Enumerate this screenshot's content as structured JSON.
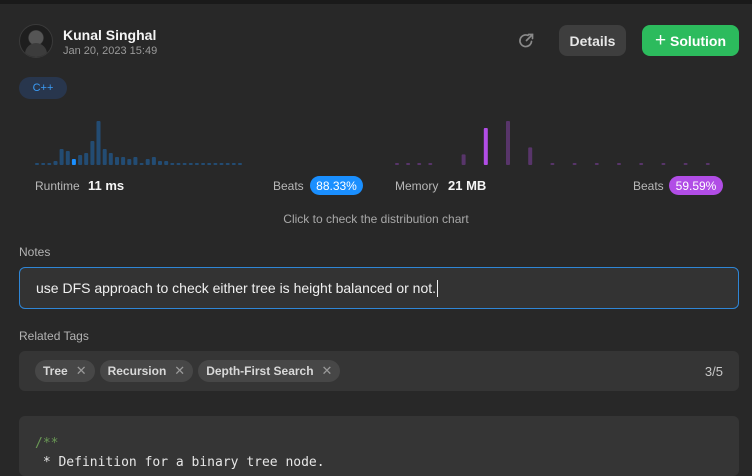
{
  "user": {
    "name": "Kunal Singhal",
    "timestamp": "Jan 20, 2023 15:49"
  },
  "header": {
    "share_icon": "share-icon",
    "details_label": "Details",
    "solution_plus": "+",
    "solution_label": "Solution"
  },
  "language": "C++",
  "runtime": {
    "label": "Runtime",
    "value": "11 ms",
    "beats_label": "Beats",
    "beats_value": "88.33%",
    "color": "#1a8fff",
    "distribution": [
      1,
      1,
      1,
      2,
      8,
      7,
      3,
      5,
      6,
      12,
      22,
      8,
      6,
      4,
      4,
      3,
      4,
      1,
      3,
      4,
      2,
      2,
      1,
      1,
      1,
      1,
      1,
      1,
      1,
      1,
      1,
      1,
      1,
      1
    ],
    "highlight_index": 6
  },
  "memory": {
    "label": "Memory",
    "value": "21 MB",
    "beats_label": "Beats",
    "beats_value": "59.59%",
    "color": "#b14de6",
    "distribution": [
      1,
      1,
      1,
      1,
      0,
      0,
      6,
      0,
      21,
      0,
      25,
      0,
      10,
      0,
      1,
      0,
      1,
      0,
      1,
      0,
      1,
      0,
      1,
      0,
      1,
      0,
      1,
      0,
      1,
      0,
      1,
      0,
      1,
      0,
      1
    ],
    "highlight_index": 8
  },
  "chart_hint": "Click to check the distribution chart",
  "notes": {
    "label": "Notes",
    "value": "use DFS approach to check either tree is height balanced or not."
  },
  "tags": {
    "label": "Related Tags",
    "items": [
      "Tree",
      "Recursion",
      "Depth-First Search"
    ],
    "remove_glyph": "✕",
    "count": "3/5"
  },
  "code": {
    "lines": [
      "/**",
      " * Definition for a binary tree node."
    ]
  }
}
